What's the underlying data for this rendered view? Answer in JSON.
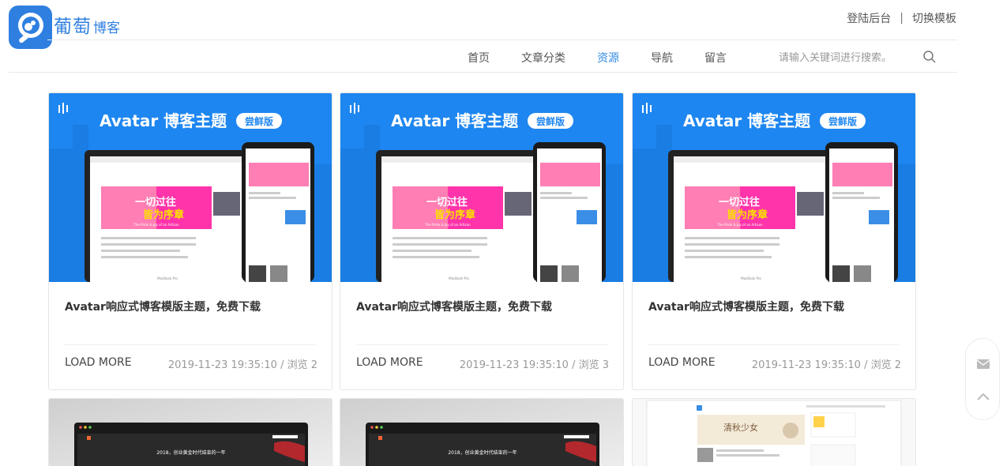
{
  "brand": {
    "logo_text": "葡萄",
    "logo_sub": "博客"
  },
  "top_links": {
    "login": "登陆后台",
    "separator": "|",
    "switch_template": "切换模板"
  },
  "nav": {
    "items": [
      {
        "label": "首页"
      },
      {
        "label": "文章分类"
      },
      {
        "label": "资源"
      },
      {
        "label": "导航"
      },
      {
        "label": "留言"
      }
    ],
    "active": "资源"
  },
  "search": {
    "placeholder": "请输入关键词进行搜索。",
    "icon": "search-icon"
  },
  "thumb_banner": {
    "title": "Avatar 博客主题",
    "badge": "尝鲜版",
    "slogan_line1": "一切过往",
    "slogan_line2": "皆为序章",
    "slogan_en": "The Pride & Joy of an Artisan",
    "laptop_label": "MacBook Pro"
  },
  "cards": [
    {
      "title": "Avatar响应式博客模版主题，免费下载",
      "load_more": "LOAD MORE",
      "meta": "2019-11-23 19:35:10 / 浏览 2"
    },
    {
      "title": "Avatar响应式博客模版主题，免费下载",
      "load_more": "LOAD MORE",
      "meta": "2019-11-23 19:35:10 / 浏览 3"
    },
    {
      "title": "Avatar响应式博客模版主题，免费下载",
      "load_more": "LOAD MORE",
      "meta": "2019-11-23 19:35:10 / 浏览 2"
    }
  ],
  "row2": {
    "card1_headline": "2018，创业黄金时代结束的一年",
    "card2_headline": "2018，创业黄金时代结束的一年",
    "card3_banner_text": "清秋少女"
  },
  "side_tools": {
    "mail_icon": "mail-icon",
    "top_icon": "back-to-top-icon"
  },
  "colors": {
    "accent": "#2f8ae5",
    "banner_blue": "#1e86f0",
    "brand": "#2f7fe0"
  }
}
